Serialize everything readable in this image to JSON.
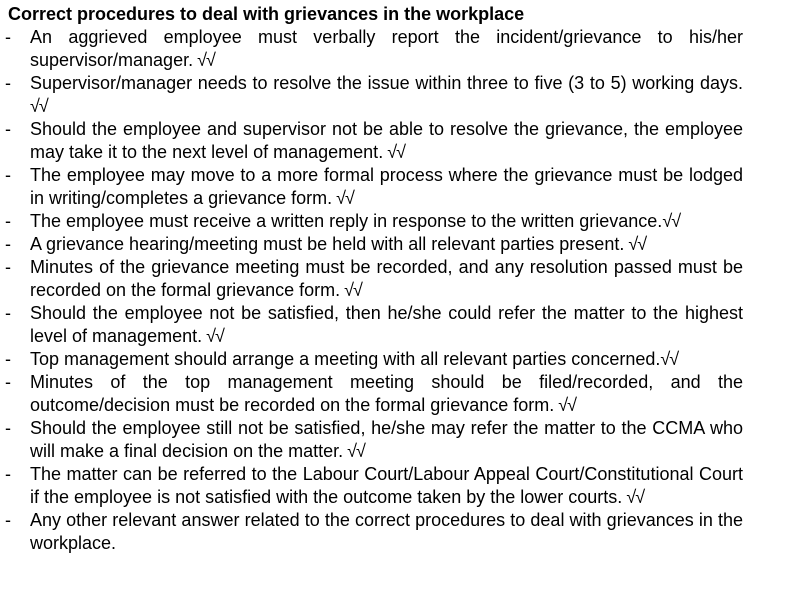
{
  "title": "Correct procedures to deal with grievances in the workplace",
  "bullet_symbol": "-",
  "items": [
    {
      "text": "An aggrieved employee must verbally report the incident/grievance to his/her supervisor/manager.",
      "ticks": " √√"
    },
    {
      "text": "Supervisor/manager needs to resolve the issue within three to five (3 to 5) working days.",
      "ticks": " √√"
    },
    {
      "text": "Should the employee and supervisor not be able to resolve the grievance, the employee may take it to the next level of management.",
      "ticks": " √√"
    },
    {
      "text": "The employee may move to a more formal process where the grievance must be lodged in writing/completes a grievance form.",
      "ticks": " √√"
    },
    {
      "text": "The employee must receive a written reply in response to the written grievance.",
      "ticks": "√√"
    },
    {
      "text": "A grievance hearing/meeting must be held with all relevant parties present.",
      "ticks": " √√"
    },
    {
      "text": "Minutes of the grievance meeting must be recorded, and any resolution passed must be recorded on the formal grievance form.",
      "ticks": " √√"
    },
    {
      "text": "Should the employee not be satisfied, then he/she could refer the matter to the highest level of management.",
      "ticks": " √√"
    },
    {
      "text": "Top management should arrange a meeting with all relevant parties concerned.",
      "ticks": "√√"
    },
    {
      "text": "Minutes of the top management meeting should be filed/recorded, and the outcome/decision must be recorded on the formal grievance form.",
      "ticks": " √√"
    },
    {
      "text": "Should the employee still not be satisfied, he/she may refer the matter to the CCMA who will make a final decision on the matter.",
      "ticks": " √√"
    },
    {
      "text": "The matter can be referred to the Labour Court/Labour Appeal Court/Constitutional Court if the employee is not satisfied with the outcome taken by the lower courts.",
      "ticks": " √√"
    },
    {
      "text": "Any other relevant answer related to the correct procedures to deal with grievances in the workplace.",
      "ticks": ""
    }
  ]
}
